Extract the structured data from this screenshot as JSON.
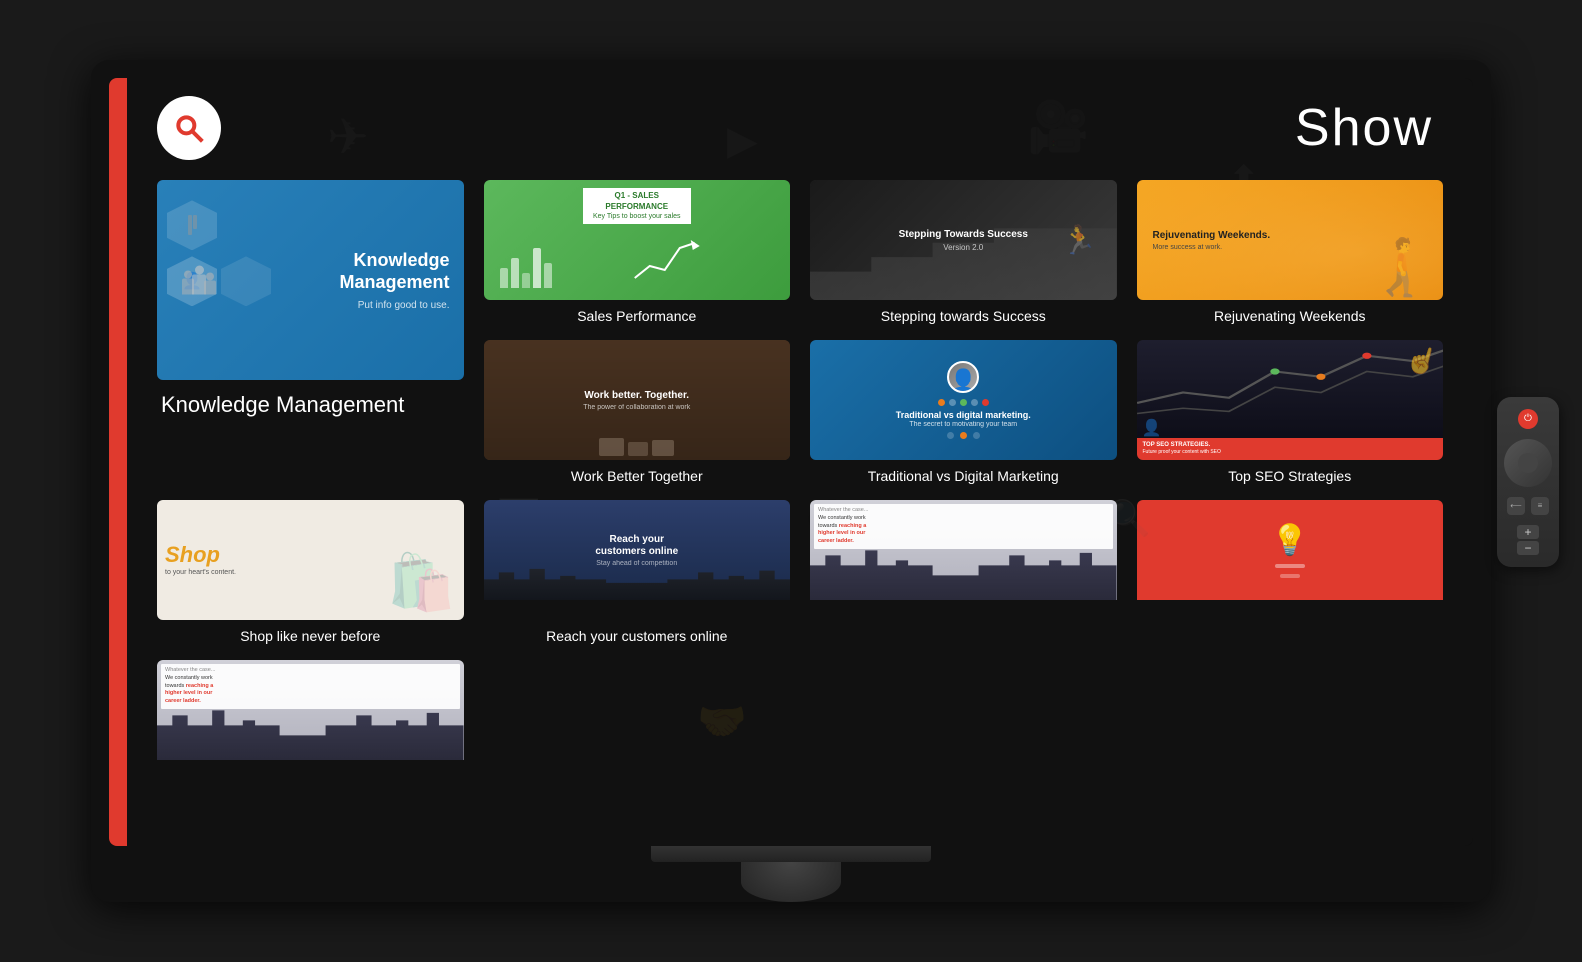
{
  "header": {
    "title": "Show",
    "search_label": "Search"
  },
  "cards": [
    {
      "id": "knowledge-management",
      "label": "Knowledge Management",
      "featured": true,
      "thumb_type": "knowledge",
      "thumb_title": "Knowledge Management",
      "thumb_sub": "Put info good to use."
    },
    {
      "id": "sales-performance",
      "label": "Sales Performance",
      "thumb_type": "sales",
      "thumb_title": "Q1 - SALES PERFORMANCE",
      "thumb_sub": "Key Tips to boost your sales"
    },
    {
      "id": "stepping-towards-success",
      "label": "Stepping towards Success",
      "thumb_type": "success",
      "thumb_title": "Stepping Towards Success",
      "thumb_sub": "Version 2.0"
    },
    {
      "id": "rejuvenating-weekends",
      "label": "Rejuvenating Weekends",
      "thumb_type": "rejuvenate",
      "thumb_title": "Rejuvenating Weekends.",
      "thumb_sub": "More success at work."
    },
    {
      "id": "work-better-together",
      "label": "Work Better Together",
      "thumb_type": "work",
      "thumb_title": "Work better. Together.",
      "thumb_sub": "The power of collaboration at work"
    },
    {
      "id": "traditional-vs-digital",
      "label": "Traditional vs Digital Marketing",
      "thumb_type": "traditional",
      "thumb_title": "Traditional vs digital marketing.",
      "thumb_sub": "The secret to motivating your team"
    },
    {
      "id": "top-seo",
      "label": "Top SEO Strategies",
      "thumb_type": "seo",
      "thumb_title": "TOP SEO STRATEGIES.",
      "thumb_sub": "Future proof your content with SEO"
    },
    {
      "id": "shop",
      "label": "Shop like never before",
      "thumb_type": "shop",
      "thumb_title": "Shop",
      "thumb_sub": "to your heart's content."
    },
    {
      "id": "reach-customers",
      "label": "Reach your customers online",
      "thumb_type": "reach",
      "thumb_title": "Reach your customers online",
      "thumb_sub": "Stay ahead of competition"
    },
    {
      "id": "career-ladder-1",
      "label": "",
      "thumb_type": "career",
      "thumb_title": "We constantly work towards reaching a higher level in our career ladder.",
      "thumb_sub": "Whatever the case..."
    },
    {
      "id": "red-idea",
      "label": "",
      "thumb_type": "red-idea"
    },
    {
      "id": "career-ladder-2",
      "label": "",
      "thumb_type": "career2",
      "thumb_title": "We constantly work towards reaching a higher level in our career ladder.",
      "thumb_sub": "Whatever the case..."
    }
  ]
}
